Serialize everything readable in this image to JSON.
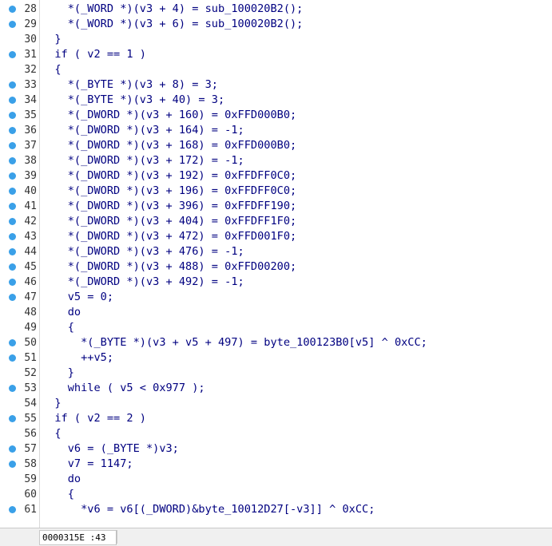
{
  "editor": {
    "lines": [
      {
        "num": "28",
        "bp": true,
        "text": "    *(_WORD *)(v3 + 4) = sub_100020B2();"
      },
      {
        "num": "29",
        "bp": true,
        "text": "    *(_WORD *)(v3 + 6) = sub_100020B2();"
      },
      {
        "num": "30",
        "bp": false,
        "text": "  }"
      },
      {
        "num": "31",
        "bp": true,
        "text": "  if ( v2 == 1 )"
      },
      {
        "num": "32",
        "bp": false,
        "text": "  {"
      },
      {
        "num": "33",
        "bp": true,
        "text": "    *(_BYTE *)(v3 + 8) = 3;"
      },
      {
        "num": "34",
        "bp": true,
        "text": "    *(_BYTE *)(v3 + 40) = 3;"
      },
      {
        "num": "35",
        "bp": true,
        "text": "    *(_DWORD *)(v3 + 160) = 0xFFD000B0;"
      },
      {
        "num": "36",
        "bp": true,
        "text": "    *(_DWORD *)(v3 + 164) = -1;"
      },
      {
        "num": "37",
        "bp": true,
        "text": "    *(_DWORD *)(v3 + 168) = 0xFFD000B0;"
      },
      {
        "num": "38",
        "bp": true,
        "text": "    *(_DWORD *)(v3 + 172) = -1;"
      },
      {
        "num": "39",
        "bp": true,
        "text": "    *(_DWORD *)(v3 + 192) = 0xFFDFF0C0;"
      },
      {
        "num": "40",
        "bp": true,
        "text": "    *(_DWORD *)(v3 + 196) = 0xFFDFF0C0;"
      },
      {
        "num": "41",
        "bp": true,
        "text": "    *(_DWORD *)(v3 + 396) = 0xFFDFF190;"
      },
      {
        "num": "42",
        "bp": true,
        "text": "    *(_DWORD *)(v3 + 404) = 0xFFDFF1F0;"
      },
      {
        "num": "43",
        "bp": true,
        "text": "    *(_DWORD *)(v3 + 472) = 0xFFD001F0;"
      },
      {
        "num": "44",
        "bp": true,
        "text": "    *(_DWORD *)(v3 + 476) = -1;"
      },
      {
        "num": "45",
        "bp": true,
        "text": "    *(_DWORD *)(v3 + 488) = 0xFFD00200;"
      },
      {
        "num": "46",
        "bp": true,
        "text": "    *(_DWORD *)(v3 + 492) = -1;"
      },
      {
        "num": "47",
        "bp": true,
        "text": "    v5 = 0;"
      },
      {
        "num": "48",
        "bp": false,
        "text": "    do"
      },
      {
        "num": "49",
        "bp": false,
        "text": "    {"
      },
      {
        "num": "50",
        "bp": true,
        "text": "      *(_BYTE *)(v3 + v5 + 497) = byte_100123B0[v5] ^ 0xCC;"
      },
      {
        "num": "51",
        "bp": true,
        "text": "      ++v5;"
      },
      {
        "num": "52",
        "bp": false,
        "text": "    }"
      },
      {
        "num": "53",
        "bp": true,
        "text": "    while ( v5 < 0x977 );"
      },
      {
        "num": "54",
        "bp": false,
        "text": "  }"
      },
      {
        "num": "55",
        "bp": true,
        "text": "  if ( v2 == 2 )"
      },
      {
        "num": "56",
        "bp": false,
        "text": "  {"
      },
      {
        "num": "57",
        "bp": true,
        "text": "    v6 = (_BYTE *)v3;"
      },
      {
        "num": "58",
        "bp": true,
        "text": "    v7 = 1147;"
      },
      {
        "num": "59",
        "bp": false,
        "text": "    do"
      },
      {
        "num": "60",
        "bp": false,
        "text": "    {"
      },
      {
        "num": "61",
        "bp": true,
        "text": "      *v6 = v6[(_DWORD)&byte_10012D27[-v3]] ^ 0xCC;"
      }
    ]
  },
  "status_bar": {
    "address": "0000315E :43"
  },
  "colors": {
    "breakpoint": "#3aa0e8",
    "code_text": "#000080",
    "variable": "#6b6bd6",
    "type": "#6b6b8a"
  }
}
